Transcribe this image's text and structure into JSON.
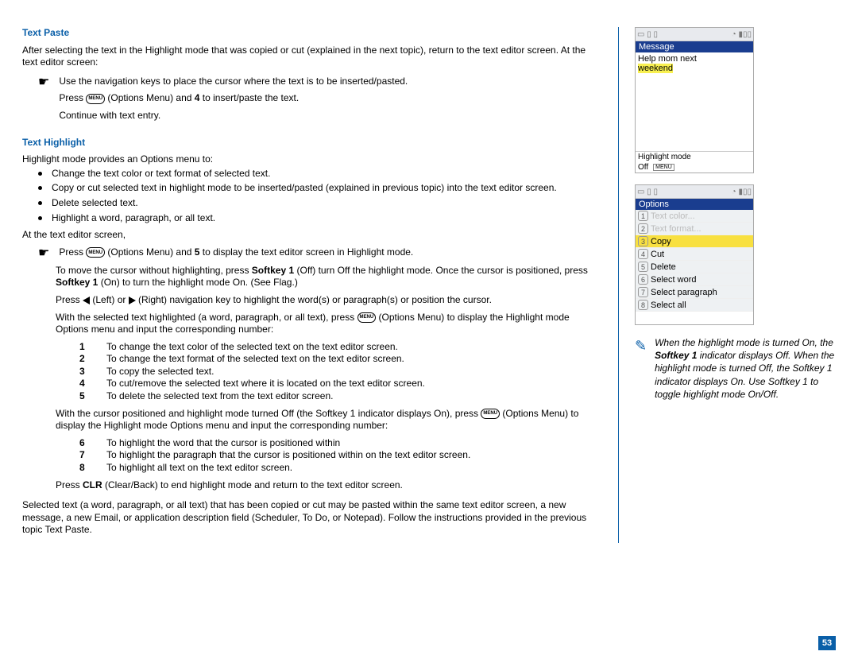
{
  "pageNumber": "53",
  "section1": {
    "title": "Text Paste",
    "intro": "After selecting the text in the Highlight mode that was copied or cut (explained in the next topic), return to the text editor screen. At the text editor screen:",
    "step1": "Use the navigation keys to place the cursor where the text is to be inserted/pasted.",
    "step2a": "Press ",
    "step2btn": "MENU",
    "step2b": " (Options Menu) and ",
    "step2bold": "4",
    "step2c": " to insert/paste the text.",
    "step3": "Continue with text entry."
  },
  "section2": {
    "title": "Text Highlight",
    "intro": "Highlight mode provides an Options menu to:",
    "b1": "Change the text color or text format of selected text.",
    "b2": "Copy or cut selected text in highlight mode to be inserted/pasted (explained in previous topic) into the text editor screen.",
    "b3": "Delete selected text.",
    "b4": "Highlight a word, paragraph, or all text.",
    "at": "At the text editor screen,",
    "p1a": "Press ",
    "p1btn": "MENU",
    "p1b": " (Options Menu) and ",
    "p1bold": "5",
    "p1c": " to display the text editor screen in Highlight mode.",
    "p2a": "To move the cursor without highlighting, press ",
    "p2k1": "Softkey 1",
    "p2b": " (Off) turn Off the highlight mode. Once the cursor is positioned, press ",
    "p2k2": "Softkey 1",
    "p2c": " (On) to turn the highlight mode On. (See Flag.)",
    "p3a": "Press ",
    " p3b": " (Left) or ",
    "p3c": " (Right) navigation key to highlight the word(s) or paragraph(s) or position the cursor.",
    "p4a": "With the selected text highlighted (a word, paragraph, or all text), press ",
    "p4btn": "MENU",
    "p4b": " (Options Menu) to display the Highlight mode Options menu and input the corresponding number:",
    "nl1": {
      "1": "To change the text color of the selected text on the text editor screen.",
      "2": "To change the text format of the selected text on the text editor screen.",
      "3": "To copy the selected text.",
      "4": "To cut/remove the selected text where it is located on the text editor screen.",
      "5": "To delete the selected text from the text editor screen."
    },
    "p5a": "With the cursor positioned and highlight mode turned Off (the Softkey 1 indicator displays On), press ",
    "p5btn": "MENU",
    "p5b": " (Options Menu) to display the Highlight mode Options menu and input the corresponding number:",
    "nl2": {
      "6": "To highlight the word that the cursor is positioned within",
      "7": "To highlight the paragraph that the cursor is positioned within on the text editor screen.",
      "8": "To highlight all text on the text editor screen."
    },
    "p6a": "Press ",
    "p6k": "CLR",
    "p6b": " (Clear/Back) to end highlight mode and return to the text editor screen.",
    "outro": "Selected text (a word, paragraph, or all text) that has been copied or cut may be pasted within the same text editor screen, a new message, a new Email, or application description field (Scheduler, To Do, or Notepad). Follow the instructions provided in the previous topic Text Paste."
  },
  "phone1": {
    "title": "Message",
    "line1": "Help mom next",
    "hl": "weekend",
    "bar": "Highlight mode",
    "foot1": "Off",
    "foot2": "MENU"
  },
  "phone2": {
    "title": "Options",
    "items": [
      {
        "n": "1",
        "t": "Text color...",
        "state": "dis"
      },
      {
        "n": "2",
        "t": "Text format...",
        "state": "dis"
      },
      {
        "n": "3",
        "t": "Copy",
        "state": "hl"
      },
      {
        "n": "4",
        "t": "Cut",
        "state": ""
      },
      {
        "n": "5",
        "t": "Delete",
        "state": ""
      },
      {
        "n": "6",
        "t": "Select word",
        "state": ""
      },
      {
        "n": "7",
        "t": "Select paragraph",
        "state": ""
      },
      {
        "n": "8",
        "t": "Select all",
        "state": ""
      }
    ]
  },
  "note": "When the highlight mode is turned On, the Softkey 1 indicator displays Off. When the highlight mode is turned Off, the Softkey 1 indicator displays On. Use Softkey 1 to toggle highlight mode On/Off.",
  "noteBold": "Softkey 1"
}
